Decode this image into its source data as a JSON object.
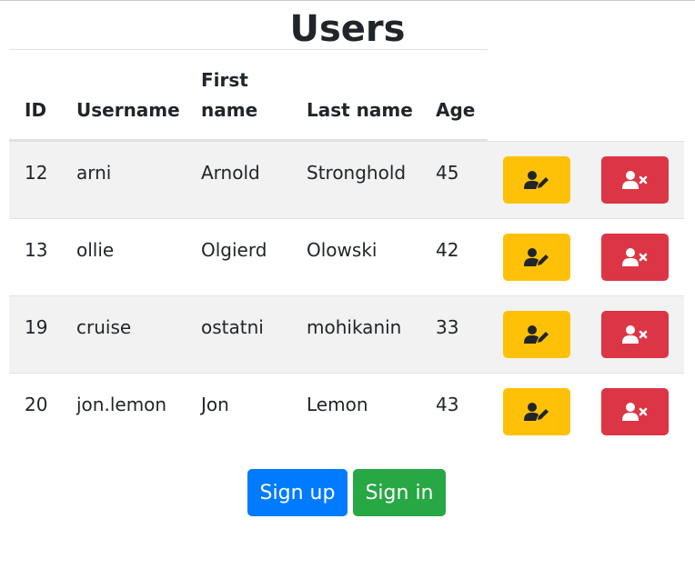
{
  "page": {
    "title": "Users"
  },
  "table": {
    "headers": {
      "id": "ID",
      "username": "Username",
      "first_name_line1": "First",
      "first_name_line2": "name",
      "last_name": "Last name",
      "age": "Age"
    },
    "rows": [
      {
        "id": "12",
        "username": "arni",
        "first_name": "Arnold",
        "last_name": "Stronghold",
        "age": "45"
      },
      {
        "id": "13",
        "username": "ollie",
        "first_name": "Olgierd",
        "last_name": "Olowski",
        "age": "42"
      },
      {
        "id": "19",
        "username": "cruise",
        "first_name": "ostatni",
        "last_name": "mohikanin",
        "age": "33"
      },
      {
        "id": "20",
        "username": "jon.lemon",
        "first_name": "Jon",
        "last_name": "Lemon",
        "age": "43"
      }
    ],
    "row_actions": {
      "edit_icon": "user-edit-icon",
      "delete_icon": "user-times-icon",
      "edit_color": "#ffc107",
      "delete_color": "#dc3545"
    }
  },
  "actions": {
    "sign_up_label": "Sign up",
    "sign_in_label": "Sign in",
    "sign_up_color": "#007bff",
    "sign_in_color": "#28a745"
  }
}
